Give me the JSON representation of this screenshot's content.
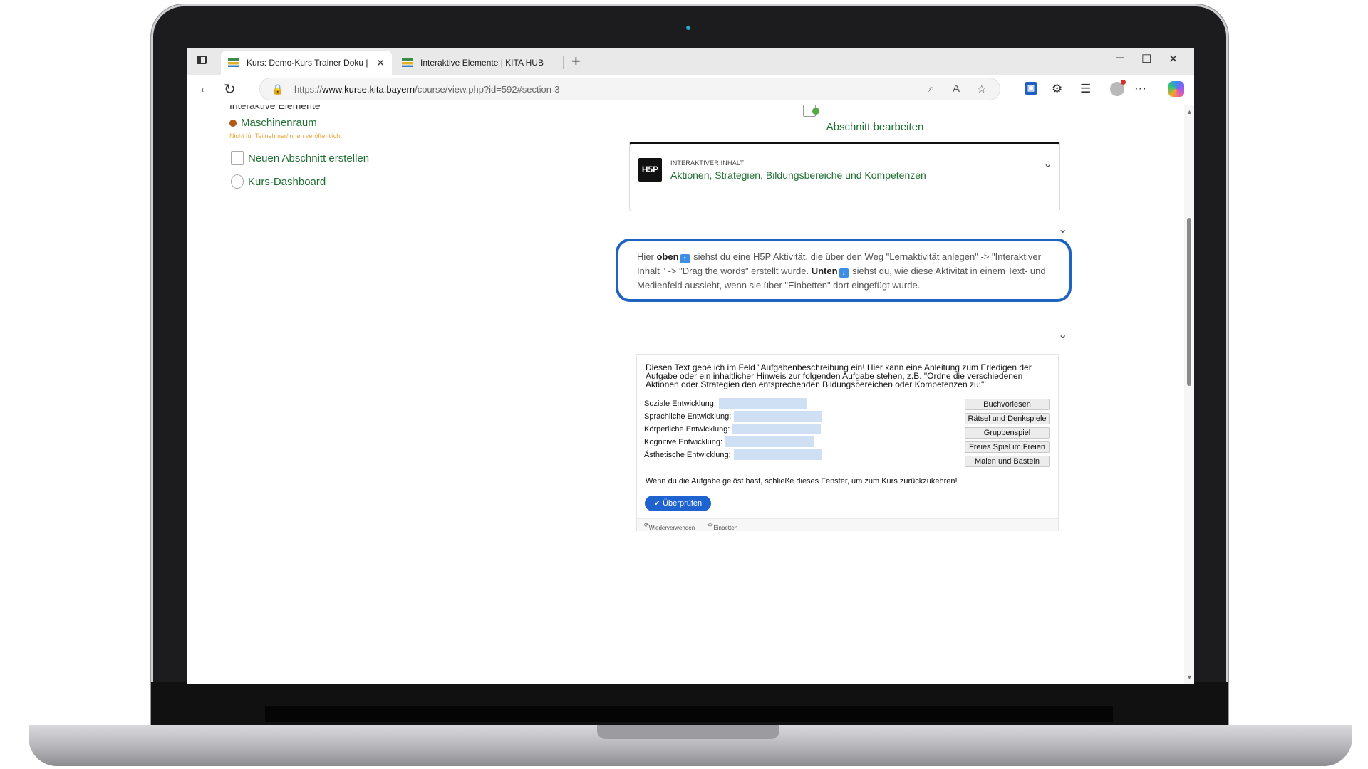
{
  "browser": {
    "tabs": [
      {
        "title": "Kurs: Demo-Kurs Trainer Doku | K",
        "active": true
      },
      {
        "title": "Interaktive Elemente | KITA HUB D",
        "active": false
      }
    ],
    "url_prefix": "https://",
    "url_domain": "www.kurse.kita.bayern",
    "url_path": "/course/view.php?id=592#section-3"
  },
  "sidebar": {
    "cut_heading": "Interaktive Elemente",
    "room_label": "Maschinenraum",
    "room_note": "Nicht für Teilnehmer/innen veröffentlicht",
    "links": [
      {
        "label": "Neuen Abschnitt erstellen",
        "icon": "new-section-icon"
      },
      {
        "label": "Kurs-Dashboard",
        "icon": "dashboard-icon"
      }
    ]
  },
  "section": {
    "edit_label": "Abschnitt bearbeiten",
    "activity": {
      "kind": "INTERAKTIVER INHALT",
      "name": "Aktionen, Strategien, Bildungsbereiche und Kompetenzen",
      "logo_text": "H5P"
    },
    "info": {
      "t1": "Hier ",
      "b1": "oben",
      "t2": " siehst du eine H5P Aktivität, die über den Weg \"Lernaktivität anlegen\" -> \"Interaktiver Inhalt \" -> \"Drag the words\" erstellt wurde. ",
      "b2": "Unten",
      "t3": " siehst du, wie diese Aktivität in einem Text- und Medienfeld aussieht, wenn sie über \"Einbetten\" dort eingefügt wurde."
    }
  },
  "h5p": {
    "intro": "Diesen Text gebe ich im Feld \"Aufgabenbeschreibung ein! Hier kann eine Anleitung zum Erledigen der Aufgabe oder ein inhaltlicher Hinweis zur folgenden Aufgabe stehen, z.B. \"Ordne die verschiedenen Aktionen oder Strategien den entsprechenden Bildungsbereichen oder Kompetenzen zu:\"",
    "fields": [
      "Soziale Entwicklung:",
      "Sprachliche Entwicklung:",
      "Körperliche Entwicklung:",
      "Kognitive Entwicklung:",
      "Ästhetische Entwicklung:"
    ],
    "words": [
      "Buchvorlesen",
      "Rätsel und Denkspiele",
      "Gruppenspiel",
      "Freies Spiel im Freien",
      "Malen und Basteln"
    ],
    "hint": "Wenn du die Aufgabe gelöst hast, schließe dieses Fenster, um zum Kurs zurückzukehren!",
    "check_label": "Überprüfen",
    "footer_reuse": "Wiederverwenden",
    "footer_embed": "Einbetten"
  },
  "colors": {
    "accent_green": "#1f6f32",
    "highlight_blue": "#1e63c0",
    "drop_zone": "#cfe0f5"
  }
}
